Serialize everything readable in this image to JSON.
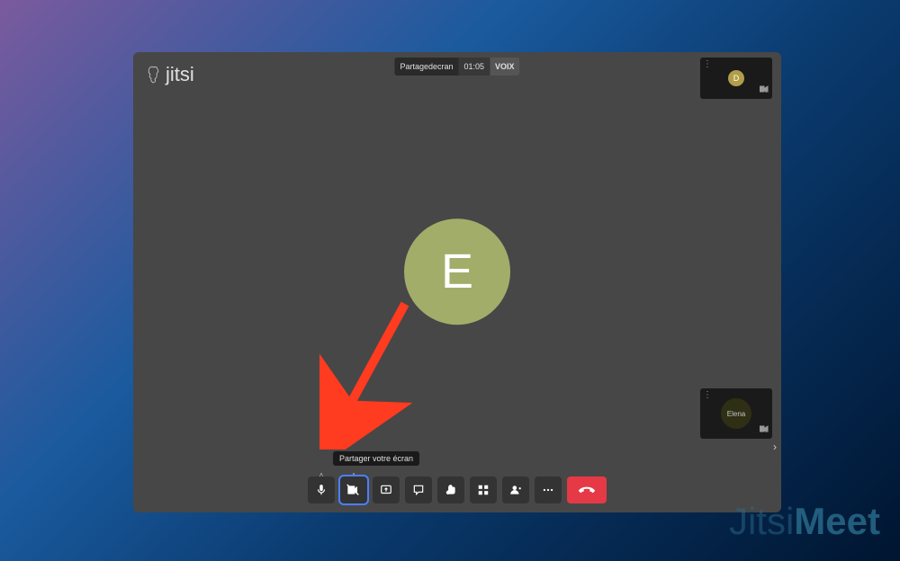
{
  "app": {
    "name": "jitsi",
    "watermark_light": "Jitsi",
    "watermark_bold": "Meet"
  },
  "header": {
    "title": "Partagedecran",
    "timer": "01:05",
    "mode": "VOIX"
  },
  "main": {
    "avatar_letter": "E"
  },
  "participants": {
    "top": {
      "letter": "D"
    },
    "bottom": {
      "name": "Elena"
    }
  },
  "tooltip": "Partager votre écran",
  "toolbar": {
    "mic": "Microphone",
    "camera": "Caméra",
    "screen": "Partager écran",
    "chat": "Chat",
    "reactions": "Réactions",
    "tiles": "Vue mosaïque",
    "participants": "Participants",
    "more": "Plus",
    "hangup": "Raccrocher"
  },
  "colors": {
    "avatar_main": "#a3ad6a",
    "avatar_d": "#b29d4a",
    "hangup": "#e63946",
    "focus": "#4a7fff",
    "arrow": "#ff3b20"
  }
}
